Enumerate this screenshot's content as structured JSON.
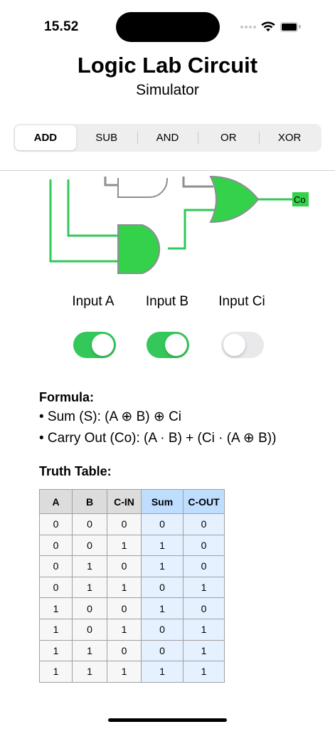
{
  "status_bar": {
    "time": "15.52"
  },
  "header": {
    "title": "Logic Lab Circuit",
    "subtitle": "Simulator"
  },
  "operations": {
    "selected": "ADD",
    "items": [
      {
        "label": "ADD"
      },
      {
        "label": "SUB"
      },
      {
        "label": "AND"
      },
      {
        "label": "OR"
      },
      {
        "label": "XOR"
      }
    ]
  },
  "circuit": {
    "output_label": "Co",
    "active_color": "#34c759",
    "inactive_color": "#8e8e93"
  },
  "inputs": [
    {
      "label": "Input A",
      "on": true
    },
    {
      "label": "Input B",
      "on": true
    },
    {
      "label": "Input Ci",
      "on": false
    }
  ],
  "formula": {
    "title": "Formula:",
    "sum": "• Sum (S): (A ⊕ B) ⊕ Ci",
    "carry": "• Carry Out (Co): (A · B) + (Ci · (A ⊕ B))"
  },
  "truth_table": {
    "title": "Truth Table:",
    "headers": [
      "A",
      "B",
      "C-IN",
      "Sum",
      "C-OUT"
    ],
    "rows": [
      [
        "0",
        "0",
        "0",
        "0",
        "0"
      ],
      [
        "0",
        "0",
        "1",
        "1",
        "0"
      ],
      [
        "0",
        "1",
        "0",
        "1",
        "0"
      ],
      [
        "0",
        "1",
        "1",
        "0",
        "1"
      ],
      [
        "1",
        "0",
        "0",
        "1",
        "0"
      ],
      [
        "1",
        "0",
        "1",
        "0",
        "1"
      ],
      [
        "1",
        "1",
        "0",
        "0",
        "1"
      ],
      [
        "1",
        "1",
        "1",
        "1",
        "1"
      ]
    ]
  }
}
